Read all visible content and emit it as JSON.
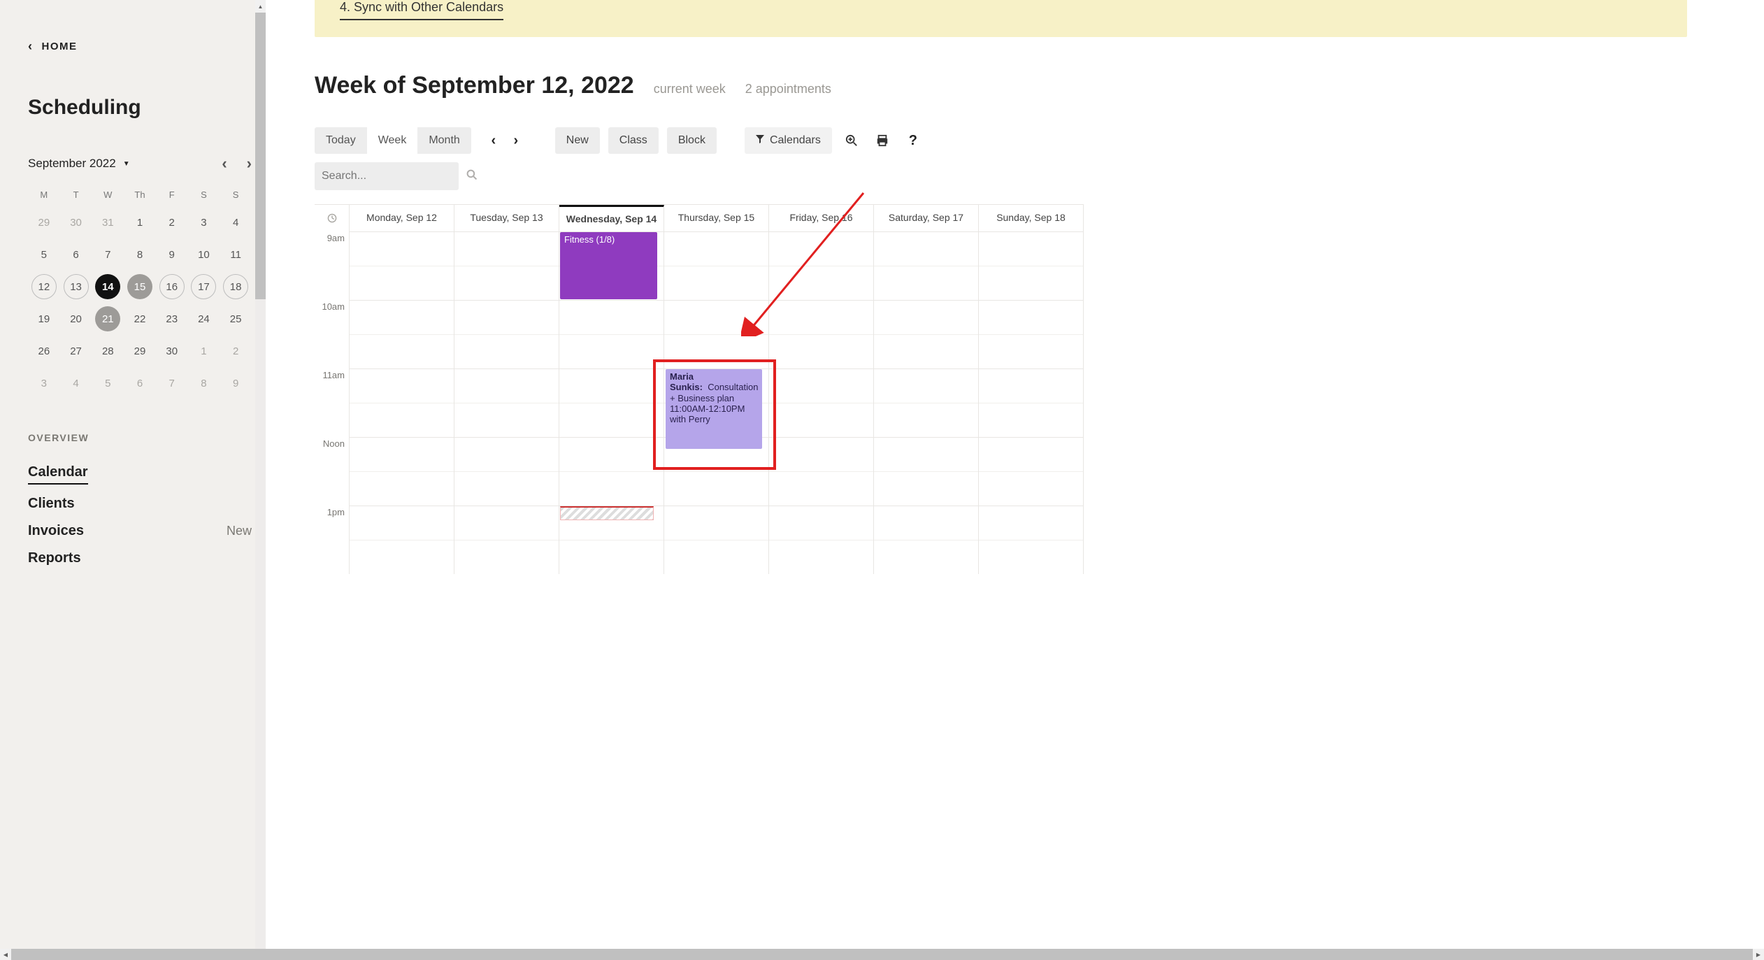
{
  "sidebar": {
    "home_label": "HOME",
    "page_title": "Scheduling",
    "month_label": "September 2022",
    "dow": [
      "M",
      "T",
      "W",
      "Th",
      "F",
      "S",
      "S"
    ],
    "weeks": [
      [
        {
          "n": "29",
          "cls": "other"
        },
        {
          "n": "30",
          "cls": "other"
        },
        {
          "n": "31",
          "cls": "other"
        },
        {
          "n": "1"
        },
        {
          "n": "2"
        },
        {
          "n": "3"
        },
        {
          "n": "4"
        }
      ],
      [
        {
          "n": "5"
        },
        {
          "n": "6"
        },
        {
          "n": "7"
        },
        {
          "n": "8"
        },
        {
          "n": "9"
        },
        {
          "n": "10"
        },
        {
          "n": "11"
        }
      ],
      [
        {
          "n": "12",
          "cls": "ring"
        },
        {
          "n": "13",
          "cls": "ring"
        },
        {
          "n": "14",
          "cls": "selected"
        },
        {
          "n": "15",
          "cls": "shade"
        },
        {
          "n": "16",
          "cls": "ring"
        },
        {
          "n": "17",
          "cls": "ring"
        },
        {
          "n": "18",
          "cls": "ring"
        }
      ],
      [
        {
          "n": "19"
        },
        {
          "n": "20"
        },
        {
          "n": "21",
          "cls": "shade2"
        },
        {
          "n": "22"
        },
        {
          "n": "23"
        },
        {
          "n": "24"
        },
        {
          "n": "25"
        }
      ],
      [
        {
          "n": "26"
        },
        {
          "n": "27"
        },
        {
          "n": "28"
        },
        {
          "n": "29"
        },
        {
          "n": "30"
        },
        {
          "n": "1",
          "cls": "other"
        },
        {
          "n": "2",
          "cls": "other"
        }
      ],
      [
        {
          "n": "3",
          "cls": "other"
        },
        {
          "n": "4",
          "cls": "other"
        },
        {
          "n": "5",
          "cls": "other"
        },
        {
          "n": "6",
          "cls": "other"
        },
        {
          "n": "7",
          "cls": "other"
        },
        {
          "n": "8",
          "cls": "other"
        },
        {
          "n": "9",
          "cls": "other"
        }
      ]
    ],
    "nav_header": "OVERVIEW",
    "nav_items": [
      {
        "label": "Calendar",
        "active": true
      },
      {
        "label": "Clients"
      },
      {
        "label": "Invoices",
        "badge": "New"
      },
      {
        "label": "Reports"
      }
    ]
  },
  "banner": {
    "item": "4. Sync with Other Calendars"
  },
  "header": {
    "title": "Week of September 12, 2022",
    "sub1": "current week",
    "sub2": "2 appointments"
  },
  "toolbar": {
    "views": [
      "Today",
      "Week",
      "Month"
    ],
    "active_view": "Week",
    "buttons": {
      "new": "New",
      "class": "Class",
      "block": "Block",
      "calendars": "Calendars"
    },
    "search_placeholder": "Search..."
  },
  "calendar": {
    "days": [
      "Monday, Sep 12",
      "Tuesday, Sep 13",
      "Wednesday, Sep 14",
      "Thursday, Sep 15",
      "Friday, Sep 16",
      "Saturday, Sep 17",
      "Sunday, Sep 18"
    ],
    "today_index": 2,
    "times": [
      "9am",
      "10am",
      "11am",
      "Noon",
      "1pm"
    ],
    "events": {
      "fitness": "Fitness (1/8)",
      "consult_title": "Maria Sunkis:",
      "consult_type": "Consultation",
      "consult_addon": "+ Business plan",
      "consult_time": "11:00AM-12:10PM",
      "consult_with": "with Perry"
    }
  }
}
